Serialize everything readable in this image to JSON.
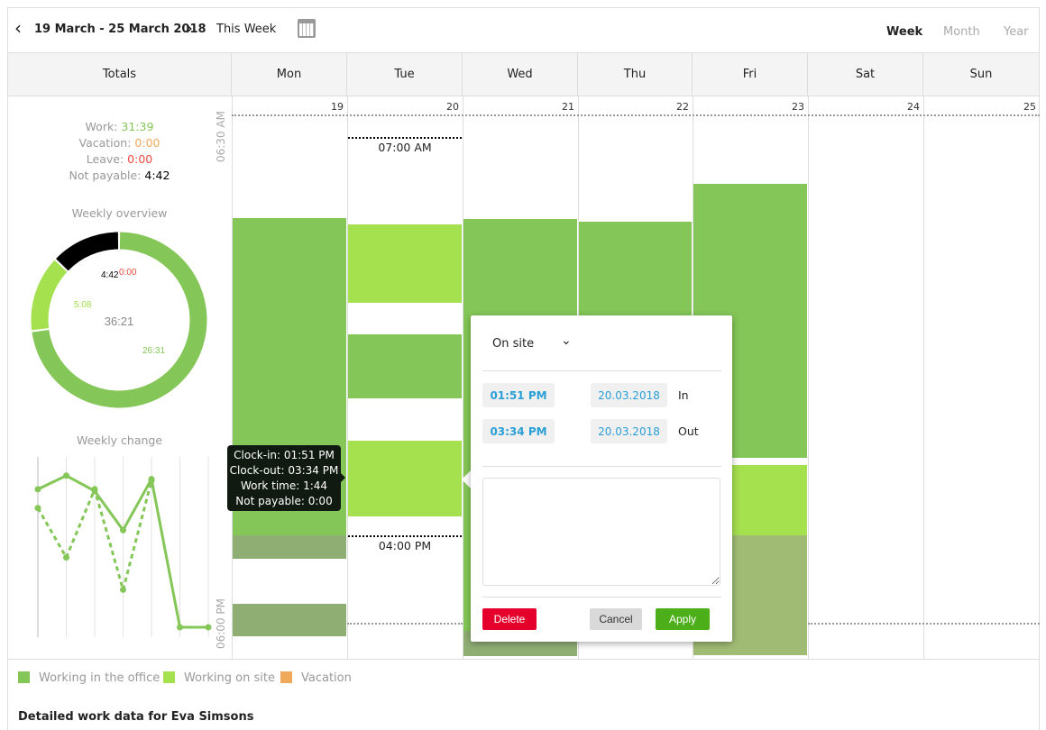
{
  "header": {
    "date_range": "19 March - 25 March 2018",
    "this_week": "This Week",
    "views": [
      "Week",
      "Month",
      "Year"
    ],
    "active_view": "Week"
  },
  "columns": {
    "totals": "Totals",
    "days": [
      "Mon",
      "Tue",
      "Wed",
      "Thu",
      "Fri",
      "Sat",
      "Sun"
    ],
    "dates": [
      "19",
      "20",
      "21",
      "22",
      "23",
      "24",
      "25"
    ]
  },
  "time_labels": {
    "start": "06:30 AM",
    "end": "06:00 PM"
  },
  "markers": {
    "tue_start": "07:00 AM",
    "tue_end": "04:00 PM"
  },
  "totals": {
    "work_label": "Work:",
    "work": "31:39",
    "vacation_label": "Vacation:",
    "vacation": "0:00",
    "leave_label": "Leave:",
    "leave": "0:00",
    "notpay_label": "Not payable:",
    "notpay": "4:42"
  },
  "colors": {
    "office": "#84c657",
    "onsite": "#a5e04f",
    "vacation": "#f0a95a",
    "notpayable": "#8fae74",
    "leave": "#e84c3d",
    "accent": "#2a9fd6",
    "delete": "#e4002b",
    "apply": "#4caf1a"
  },
  "chart_data": [
    {
      "type": "pie",
      "title": "Weekly overview",
      "center_label": "36:21",
      "slices": [
        {
          "label": "26:31",
          "value": 26.52,
          "color": "#84c657"
        },
        {
          "label": "5:08",
          "value": 5.13,
          "color": "#a5e04f"
        },
        {
          "label": "4:42",
          "value": 4.7,
          "color": "#000000"
        },
        {
          "label": "0:00",
          "value": 0,
          "color": "#e84c3d"
        }
      ]
    },
    {
      "type": "line",
      "title": "Weekly change",
      "x": [
        1,
        2,
        3,
        4,
        5,
        6,
        7
      ],
      "grid": "vertical",
      "series": [
        {
          "style": "solid",
          "values": [
            8.1,
            8.9,
            8.0,
            5.7,
            8.7,
            0,
            0
          ]
        },
        {
          "style": "dashed",
          "values": [
            7.0,
            4.1,
            8.1,
            2.2,
            8.6
          ]
        }
      ]
    }
  ],
  "tooltip": {
    "lines": [
      "Clock-in: 01:51 PM",
      "Clock-out: 03:34 PM",
      "Work time: 1:44",
      "Not payable: 0:00"
    ]
  },
  "popup": {
    "type": "On site",
    "in_time": "01:51 PM",
    "in_date": "20.03.2018",
    "in_label": "In",
    "out_time": "03:34 PM",
    "out_date": "20.03.2018",
    "out_label": "Out",
    "note": "",
    "delete": "Delete",
    "cancel": "Cancel",
    "apply": "Apply"
  },
  "legend": [
    "Working in the office",
    "Working on site",
    "Vacation"
  ],
  "footer": {
    "title": "Detailed work data for Eva Simsons"
  }
}
